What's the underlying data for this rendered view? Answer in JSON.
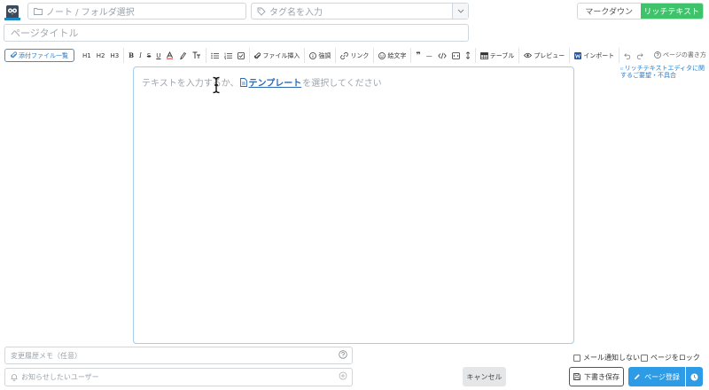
{
  "header": {
    "notebook_placeholder": "ノート / フォルダ選択",
    "tag_placeholder": "タグ名を入力",
    "mode_markdown": "マークダウン",
    "mode_richtext": "リッチテキスト",
    "active_mode": "richtext"
  },
  "title": {
    "placeholder": "ページタイトル"
  },
  "toolbar": {
    "attach_label": "添付ファイル一覧",
    "h1": "H1",
    "h2": "H2",
    "h3": "H3",
    "bold": "B",
    "italic": "I",
    "strike": "S",
    "underline": "U",
    "file_insert": "ファイル挿入",
    "emphasis": "強調",
    "link": "リンク",
    "emoji": "絵文字",
    "quote": "❞",
    "hr": "—",
    "table": "テーブル",
    "preview": "プレビュー",
    "import": "インポート",
    "help": "ページの書き方",
    "feedback_line1": "リッチテキストエディタに関",
    "feedback_line2": "するご要望・不具合"
  },
  "editor": {
    "placeholder_before": "テキストを入力するか、",
    "template_link": "テンプレート",
    "placeholder_after": "を選択してください"
  },
  "footer": {
    "memo_placeholder": "変更履歴メモ（任意）",
    "notify_placeholder": "お知らせしたいユーザー",
    "cancel": "キャンセル",
    "no_mail": "メール通知しない",
    "lock_page": "ページをロック",
    "save_draft": "下書き保存",
    "submit": "ページ登録"
  },
  "colors": {
    "accent_green": "#3ec36a",
    "accent_blue": "#2e9be6",
    "link_blue": "#2a7cc7",
    "editor_border": "#9fd0ec"
  }
}
